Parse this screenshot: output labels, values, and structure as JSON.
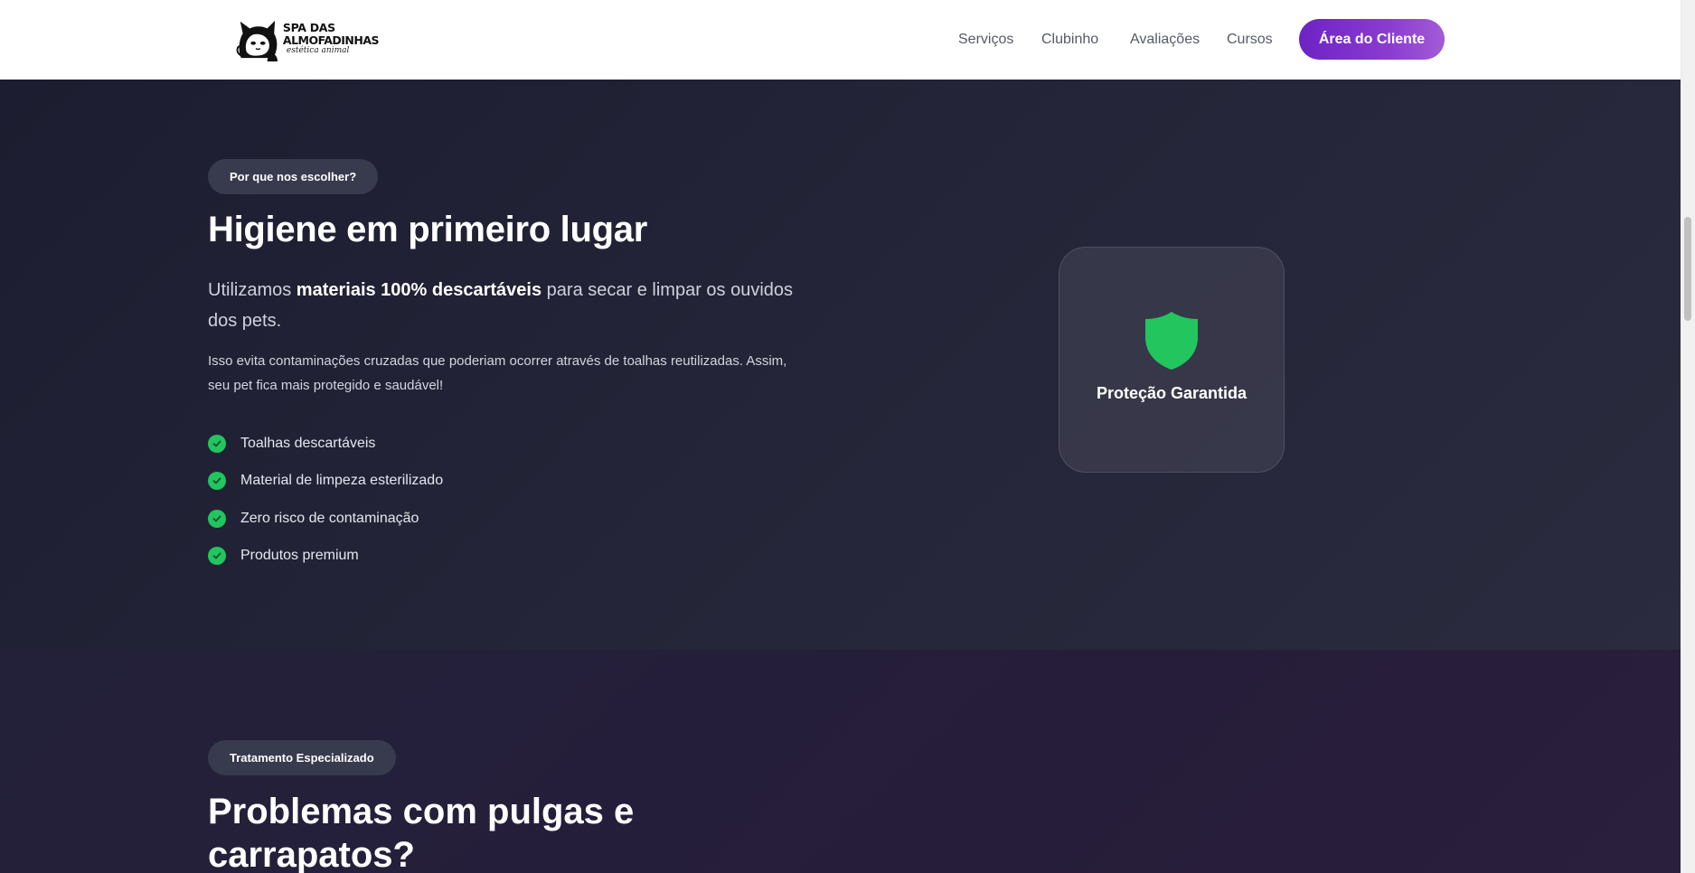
{
  "brand": {
    "line1": "SPA DAS",
    "line2": "ALMOFADINHAS",
    "line3": "estética animal"
  },
  "nav": {
    "items": [
      "Serviços",
      "Clubinho",
      "Avaliações",
      "Cursos"
    ],
    "cta_label": "Área do Cliente"
  },
  "hygiene": {
    "badge": "Por que nos escolher?",
    "title": "Higiene em primeiro lugar",
    "lead_prefix": "Utilizamos ",
    "lead_strong": "materiais 100% descartáveis",
    "lead_suffix": " para secar e limpar os ouvidos dos pets.",
    "body": "Isso evita contaminações cruzadas que poderiam ocorrer através de toalhas reutilizadas. Assim, seu pet fica mais protegido e saudável!",
    "checklist": [
      "Toalhas descartáveis",
      "Material de limpeza esterilizado",
      "Zero risco de contaminação",
      "Produtos premium"
    ],
    "card_label": "Proteção Garantida"
  },
  "fleas": {
    "badge": "Tratamento Especializado",
    "title": "Problemas com pulgas e carrapatos?"
  },
  "colors": {
    "accent_purple": "#6d22c4",
    "check_green": "#22c55e",
    "dark_bg": "#1f2033"
  },
  "icons": {
    "check": "check-circle-icon",
    "shield": "shield-icon",
    "logo": "cat-logo-icon"
  }
}
